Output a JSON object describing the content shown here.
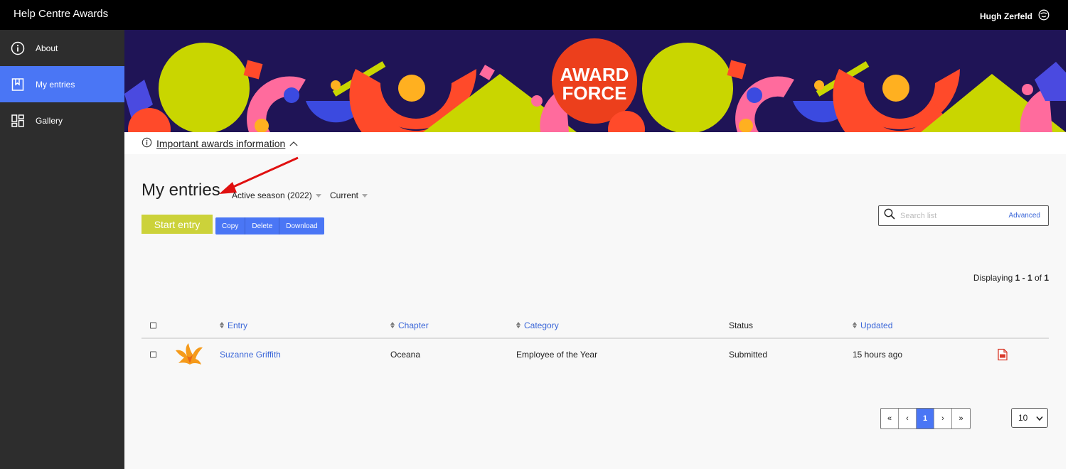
{
  "app": {
    "title": "Help Centre Awards",
    "user_name": "Hugh Zerfeld"
  },
  "sidebar": {
    "items": [
      {
        "label": "About",
        "icon": "info-icon",
        "active": false
      },
      {
        "label": "My entries",
        "icon": "bookmark-icon",
        "active": true
      },
      {
        "label": "Gallery",
        "icon": "grid-icon",
        "active": false
      }
    ]
  },
  "banner": {
    "logo_line1": "AWARD",
    "logo_line2": "FORCE"
  },
  "info": {
    "link_text": "Important awards information"
  },
  "page": {
    "title": "My entries",
    "season_filter": "Active season (2022)",
    "status_filter": "Current"
  },
  "toolbar": {
    "start_label": "Start entry",
    "copy_label": "Copy",
    "delete_label": "Delete",
    "download_label": "Download"
  },
  "search": {
    "placeholder": "Search list",
    "advanced_label": "Advanced"
  },
  "displaying": {
    "prefix": "Displaying ",
    "range": "1 - 1",
    "of": " of ",
    "total": "1"
  },
  "table": {
    "columns": {
      "entry": "Entry",
      "chapter": "Chapter",
      "category": "Category",
      "status": "Status",
      "updated": "Updated"
    },
    "rows": [
      {
        "entry": "Suzanne Griffith",
        "chapter": "Oceana",
        "category": "Employee of the Year",
        "status": "Submitted",
        "updated": "15 hours ago"
      }
    ]
  },
  "pagination": {
    "first": "«",
    "prev": "‹",
    "current": "1",
    "next": "›",
    "last": "»",
    "per_page": "10"
  },
  "colors": {
    "accent": "#4a76f5",
    "start_button": "#ccd23a",
    "banner_bg": "#1f1456",
    "sidebar_bg": "#2d2d2d",
    "logo_red": "#ec3f1c"
  }
}
